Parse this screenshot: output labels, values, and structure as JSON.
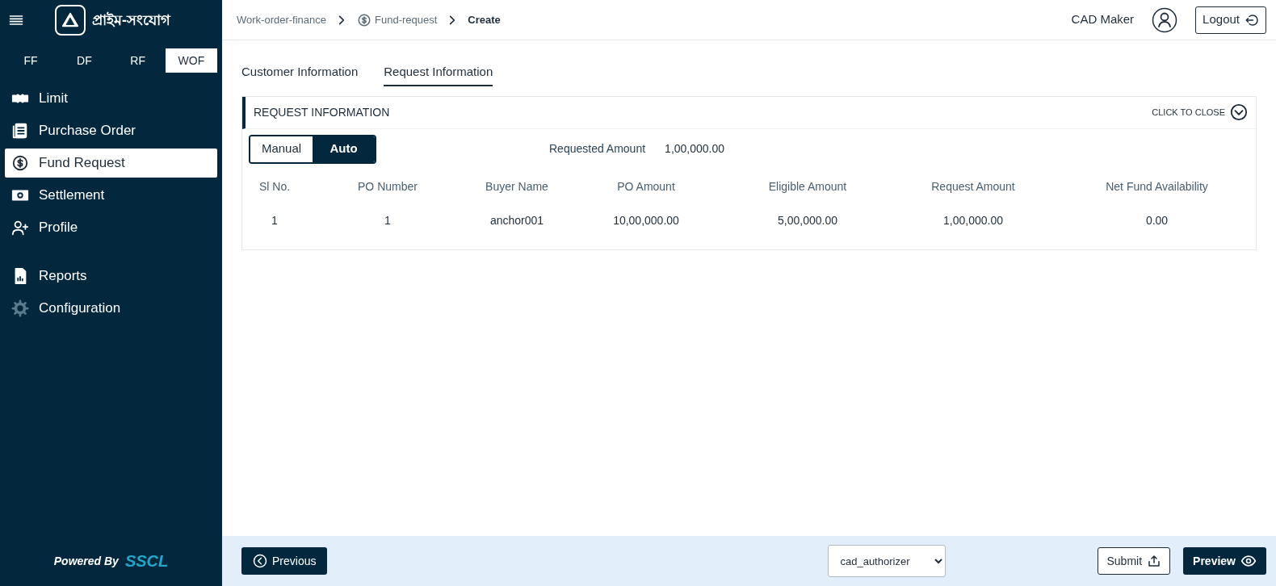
{
  "sidebar": {
    "logo_text": "প্রাইম-সংযোগ",
    "product_tabs": [
      {
        "label": "FF",
        "selected": false
      },
      {
        "label": "DF",
        "selected": false
      },
      {
        "label": "RF",
        "selected": false
      },
      {
        "label": "WOF",
        "selected": true
      }
    ],
    "nav_items": [
      {
        "label": "Limit",
        "selected": false
      },
      {
        "label": "Purchase Order",
        "selected": false
      },
      {
        "label": "Fund Request",
        "selected": true
      },
      {
        "label": "Settlement",
        "selected": false
      },
      {
        "label": "Profile",
        "selected": false
      }
    ],
    "secondary_items": [
      {
        "label": "Reports",
        "selected": false
      },
      {
        "label": "Configuration",
        "selected": false
      }
    ],
    "footer": {
      "powered_by": "Powered By",
      "brand": "SSCL"
    }
  },
  "header": {
    "breadcrumbs": [
      {
        "label": "Work-order-finance",
        "current": false
      },
      {
        "label": "Fund-request",
        "current": false
      },
      {
        "label": "Create",
        "current": true
      }
    ],
    "user_name": "CAD Maker",
    "logout": "Logout"
  },
  "tabs": [
    {
      "label": "Customer Information",
      "selected": false
    },
    {
      "label": "Request Information",
      "selected": true
    }
  ],
  "panel": {
    "title": "REQUEST INFORMATION",
    "close_label": "CLICK TO CLOSE",
    "mode_toggle": [
      {
        "label": "Manual",
        "selected": false
      },
      {
        "label": "Auto",
        "selected": true
      }
    ],
    "requested_amount_label": "Requested Amount",
    "requested_amount": "1,00,000.00",
    "table": {
      "columns": [
        "Sl No.",
        "PO Number",
        "Buyer Name",
        "PO Amount",
        "Eligible Amount",
        "Request Amount",
        "Net Fund Availability"
      ],
      "rows": [
        [
          "1",
          "1",
          "anchor001",
          "10,00,000.00",
          "5,00,000.00",
          "1,00,000.00",
          "0.00"
        ]
      ]
    }
  },
  "footer": {
    "previous": "Previous",
    "assignee": "cad_authorizer",
    "submit": "Submit",
    "preview": "Preview"
  }
}
